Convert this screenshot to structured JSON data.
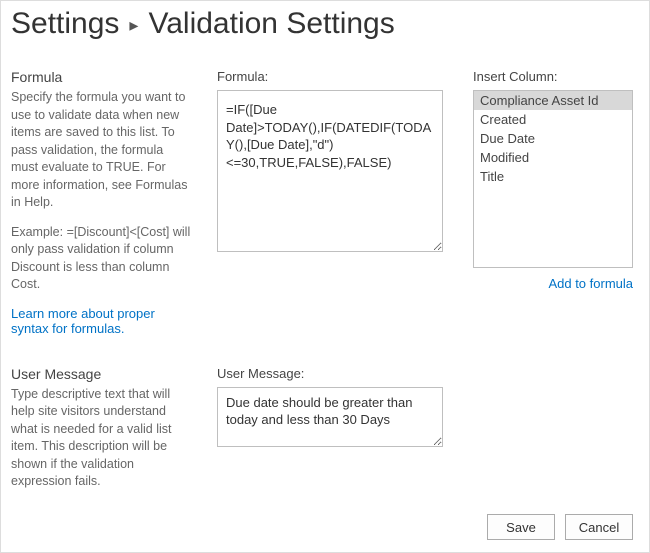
{
  "header": {
    "settings": "Settings",
    "subtitle": "Validation Settings"
  },
  "formula_section": {
    "title": "Formula",
    "desc": "Specify the formula you want to use to validate data when new items are saved to this list. To pass validation, the formula must evaluate to TRUE. For more information, see Formulas in Help.",
    "example": "Example: =[Discount]<[Cost] will only pass validation if column Discount is less than column Cost.",
    "help_link": "Learn more about proper syntax for formulas."
  },
  "formula_field": {
    "label": "Formula:",
    "value": "=IF([Due Date]>TODAY(),IF(DATEDIF(TODAY(),[Due Date],\"d\")<=30,TRUE,FALSE),FALSE)"
  },
  "insert_column": {
    "label": "Insert Column:",
    "items": [
      "Compliance Asset Id",
      "Created",
      "Due Date",
      "Modified",
      "Title"
    ],
    "selected_index": 0,
    "add_link": "Add to formula"
  },
  "user_message_section": {
    "title": "User Message",
    "desc": "Type descriptive text that will help site visitors understand what is needed for a valid list item. This description will be shown if the validation expression fails."
  },
  "user_message_field": {
    "label": "User Message:",
    "value": "Due date should be greater than today and less than 30 Days"
  },
  "buttons": {
    "save": "Save",
    "cancel": "Cancel"
  }
}
